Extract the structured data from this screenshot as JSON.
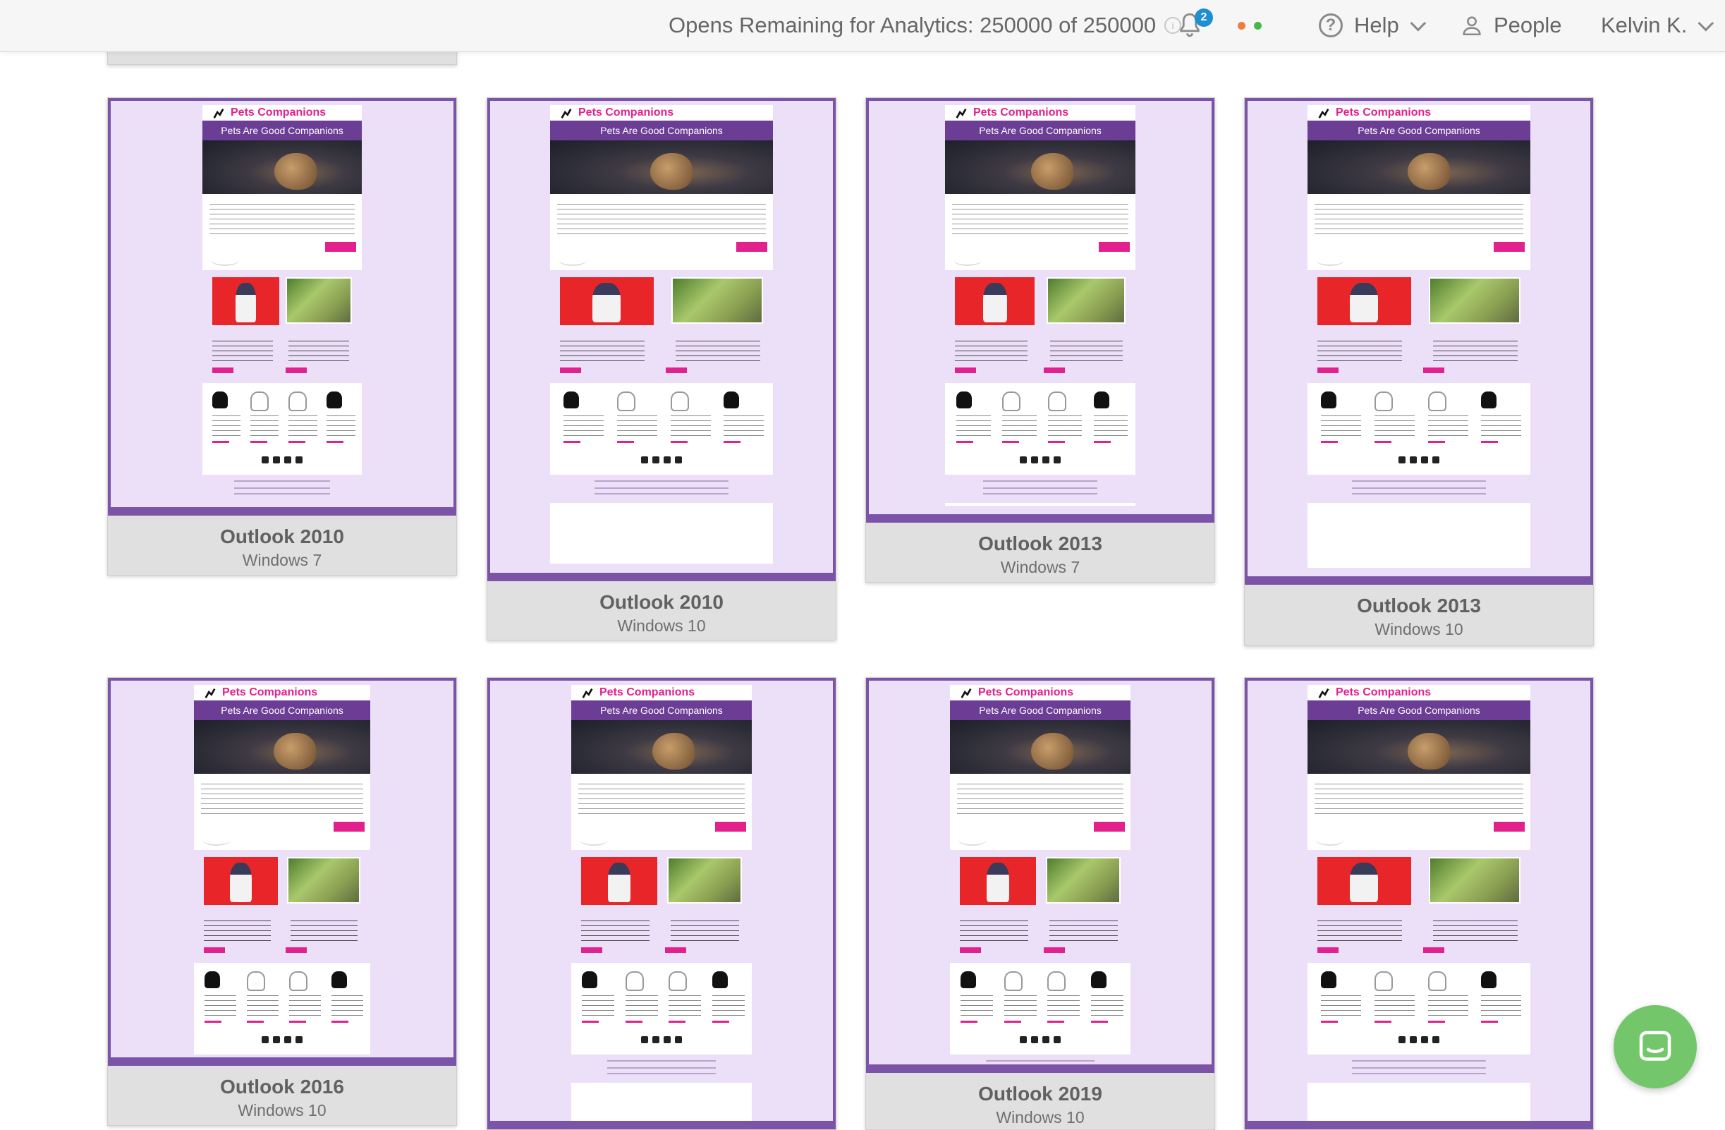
{
  "topbar": {
    "opens_label": "Opens Remaining for Analytics: 250000 of 250000",
    "notification_count": "2",
    "help_label": "Help",
    "people_label": "People",
    "user_label": "Kelvin K."
  },
  "colors": {
    "frame_purple": "#7b54a8",
    "preview_bg": "#ecdff8",
    "brand_pink": "#e2218c",
    "banner_purple": "#6b3d95",
    "status_dot_orange": "#f07b3f",
    "status_dot_green": "#47b847",
    "chat_green": "#73c76a",
    "badge_blue": "#1f8fd1"
  },
  "email": {
    "brand": "Pets Companions",
    "banner": "Pets Are Good Companions"
  },
  "previews": [
    {
      "client": "Outlook 2010",
      "os": "Windows 7"
    },
    {
      "client": "Outlook 2010",
      "os": "Windows 10"
    },
    {
      "client": "Outlook 2013",
      "os": "Windows 7"
    },
    {
      "client": "Outlook 2013",
      "os": "Windows 10"
    },
    {
      "client": "Outlook 2016",
      "os": "Windows 10"
    },
    {
      "client": "",
      "os": ""
    },
    {
      "client": "Outlook 2019",
      "os": "Windows 10"
    },
    {
      "client": "",
      "os": ""
    }
  ],
  "icons": [
    "info-icon",
    "bell-icon",
    "help-icon",
    "chevron-down-icon",
    "person-icon",
    "chat-icon",
    "paw-icon"
  ]
}
